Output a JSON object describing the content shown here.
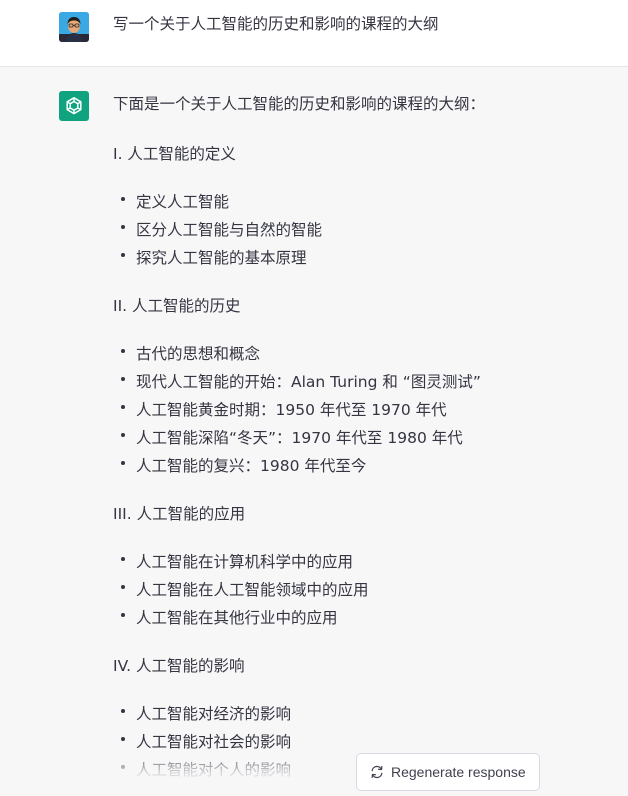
{
  "user_message": {
    "avatar": "user-avatar",
    "text": "写一个关于人工智能的历史和影响的课程的大纲"
  },
  "assistant_message": {
    "icon": "openai-logo-icon",
    "intro": "下面是一个关于人工智能的历史和影响的课程的大纲：",
    "sections": [
      {
        "heading": "I. 人工智能的定义",
        "items": [
          "定义人工智能",
          "区分人工智能与自然的智能",
          "探究人工智能的基本原理"
        ]
      },
      {
        "heading": "II. 人工智能的历史",
        "items": [
          "古代的思想和概念",
          "现代人工智能的开始：Alan Turing 和 “图灵测试”",
          "人工智能黄金时期：1950 年代至 1970 年代",
          "人工智能深陷“冬天”：1970 年代至 1980 年代",
          "人工智能的复兴：1980 年代至今"
        ]
      },
      {
        "heading": "III. 人工智能的应用",
        "items": [
          "人工智能在计算机科学中的应用",
          "人工智能在人工智能领域中的应用",
          "人工智能在其他行业中的应用"
        ]
      },
      {
        "heading": "IV. 人工智能的影响",
        "items": [
          "人工智能对经济的影响",
          "人工智能对社会的影响",
          "人工智能对个人的影响"
        ]
      }
    ]
  },
  "regenerate_button": {
    "icon": "refresh-icon",
    "label": "Regenerate response"
  },
  "colors": {
    "background_assistant": "#f7f7f8",
    "openai_green": "#10a37f",
    "text": "#343541"
  }
}
